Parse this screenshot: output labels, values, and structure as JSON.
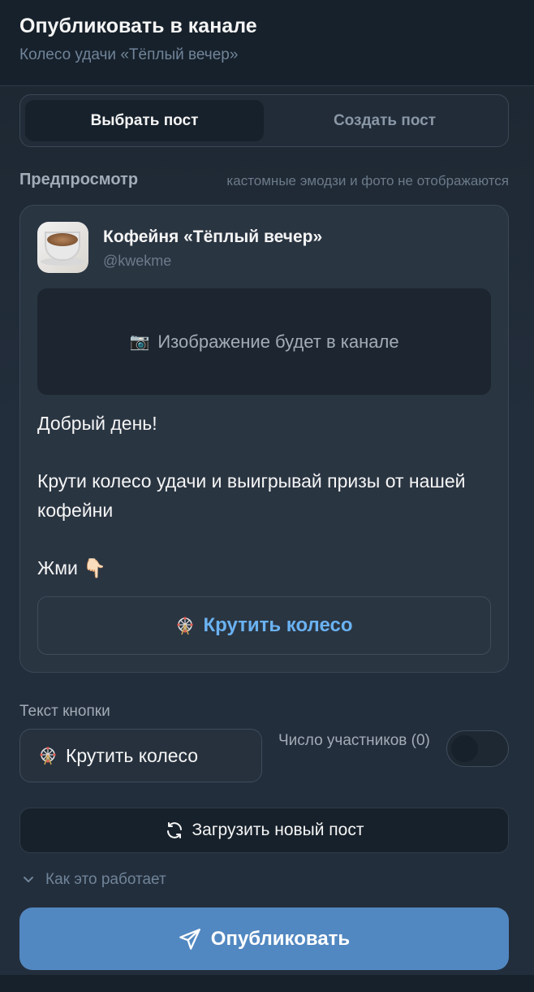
{
  "header": {
    "title": "Опубликовать в канале",
    "subtitle": "Колесо удачи «Тёплый вечер»"
  },
  "tabs": {
    "select": "Выбрать пост",
    "create": "Создать пост",
    "active": "select"
  },
  "preview": {
    "label": "Предпросмотр",
    "note": "кастомные эмодзи и фото не отображаются",
    "channel_name": "Кофейня «Тёплый вечер»",
    "channel_handle": "@kwekme",
    "image_placeholder_icon": "📷",
    "image_placeholder": "Изображение будет в канале",
    "text": {
      "line1": "Добрый день!",
      "line2": "Крути колесо удачи и выигрывай призы от нашей кофейни",
      "line3": "Жми 👇🏻"
    },
    "button_label": "Крутить колесо"
  },
  "button_text": {
    "label": "Текст кнопки",
    "value": "Крутить колесо"
  },
  "participants": {
    "label": "Число участников (0)",
    "enabled": false
  },
  "reload_label": "Загрузить новый пост",
  "how_it_works": "Как это работает",
  "publish_label": "Опубликовать",
  "colors": {
    "accent": "#5288c1",
    "link": "#6ab2f2",
    "background": "#232e3c",
    "header": "#17212b"
  }
}
